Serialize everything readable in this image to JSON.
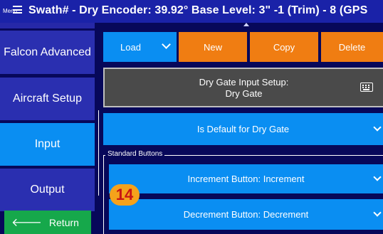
{
  "header": {
    "menu_label": "Menu",
    "title": "Swath# -   Dry Encoder: 39.92°   Base Level: 3\" -1 (Trim) - 8 (GPS"
  },
  "sidebar": {
    "items": [
      {
        "label": "Falcon Advanced"
      },
      {
        "label": "Aircraft Setup"
      },
      {
        "label": "Input"
      },
      {
        "label": "Output"
      }
    ],
    "return_label": "Return"
  },
  "toolbar": {
    "load_label": "Load",
    "new_label": "New",
    "copy_label": "Copy",
    "delete_label": "Delete"
  },
  "dry_gate": {
    "line1": "Dry Gate Input Setup:",
    "line2": "Dry Gate"
  },
  "default_button_label": "Is Default for Dry Gate",
  "standard_buttons": {
    "group_label": "Standard Buttons",
    "increment_label": "Increment Button: Increment",
    "decrement_label": "Decrement Button: Decrement"
  },
  "badge": "14",
  "colors": {
    "header_bg": "#1a22a8",
    "page_bg": "#07085a",
    "sidebar_button": "#2a2fb0",
    "active_blue": "#0a8ef2",
    "orange": "#f07d12",
    "return_green": "#16a84b",
    "gate_gray": "#4a4a4a",
    "badge_bg": "#f5a21b",
    "badge_text": "#c81414"
  }
}
